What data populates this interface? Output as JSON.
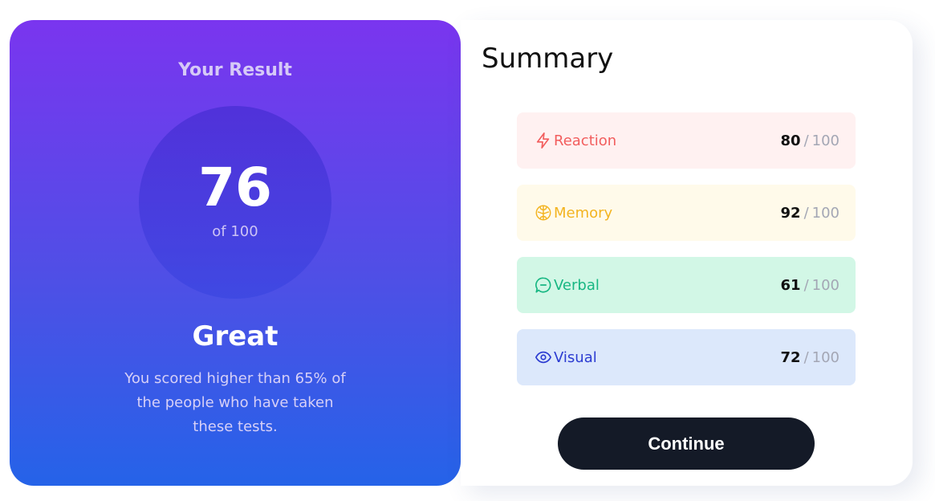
{
  "result": {
    "title": "Your Result",
    "score": "76",
    "of_label": "of 100",
    "verdict": "Great",
    "description": "You scored higher than 65% of the people who have taken these tests."
  },
  "summary": {
    "title": "Summary",
    "items": [
      {
        "label": "Reaction",
        "score": "80",
        "max": "100",
        "icon": "lightning-icon",
        "color": "#f25d5d",
        "bg": "#fff1f1"
      },
      {
        "label": "Memory",
        "score": "92",
        "max": "100",
        "icon": "brain-icon",
        "color": "#f3b421",
        "bg": "#fffaea"
      },
      {
        "label": "Verbal",
        "score": "61",
        "max": "100",
        "icon": "chat-bubble-icon",
        "color": "#18b783",
        "bg": "#d2f7e6"
      },
      {
        "label": "Visual",
        "score": "72",
        "max": "100",
        "icon": "eye-icon",
        "color": "#2b3bd1",
        "bg": "#dce8fb"
      }
    ],
    "separator": "/",
    "continue_label": "Continue"
  },
  "colors": {
    "gradient_top": "#7a35ef",
    "gradient_bottom": "#2563e8",
    "button_bg": "#141a27"
  }
}
